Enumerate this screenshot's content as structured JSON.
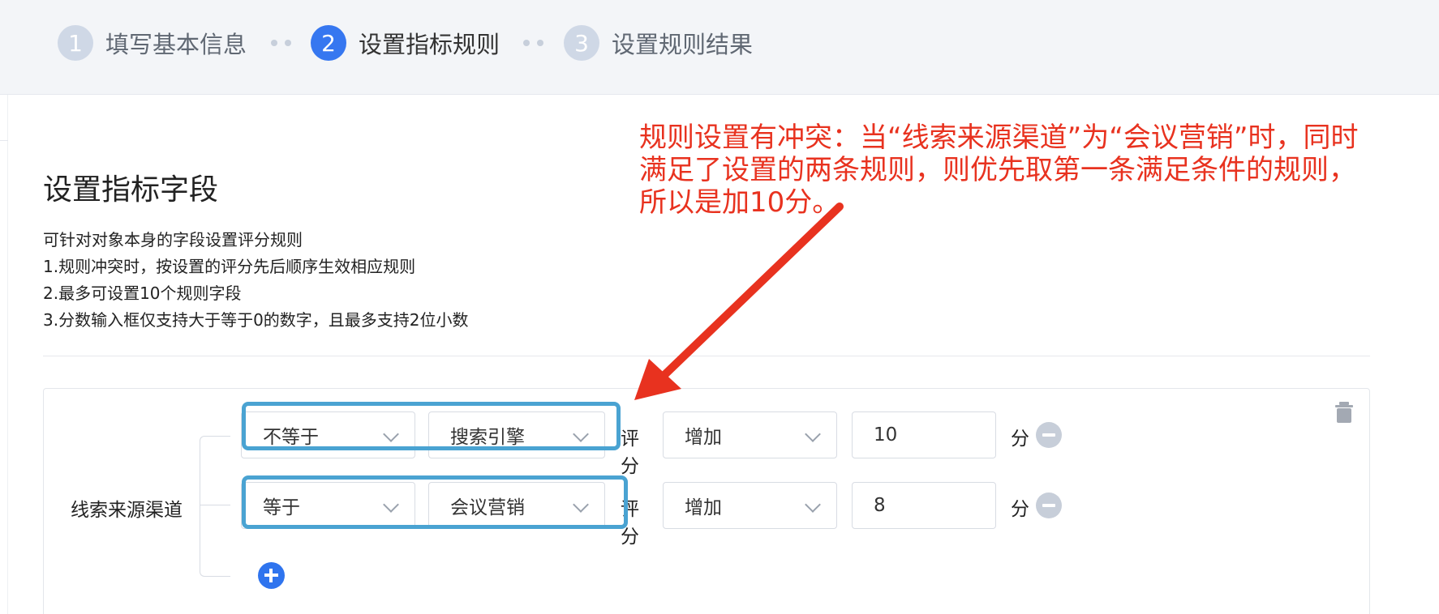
{
  "steps": [
    {
      "num": "1",
      "label": "填写基本信息",
      "state": "done"
    },
    {
      "num": "2",
      "label": "设置指标规则",
      "state": "active"
    },
    {
      "num": "3",
      "label": "设置规则结果",
      "state": "todo"
    }
  ],
  "section": {
    "title": "设置指标字段",
    "desc": [
      "可针对对象本身的字段设置评分规则",
      "1.规则冲突时，按设置的评分先后顺序生效相应规则",
      "2.最多可设置10个规则字段",
      "3.分数输入框仅支持大于等于0的数字，且最多支持2位小数"
    ]
  },
  "rule": {
    "field_name": "线索来源渠道",
    "score_label": "评分",
    "unit": "分",
    "rows": [
      {
        "operator": "不等于",
        "value": "搜索引擎",
        "action": "增加",
        "score": "10"
      },
      {
        "operator": "等于",
        "value": "会议营销",
        "action": "增加",
        "score": "8"
      }
    ]
  },
  "annotation": {
    "lines": [
      "规则设置有冲突：当“线索来源渠道”为“会议营销”时，同时",
      "满足了设置的两条规则，则优先取第一条满足条件的规则，",
      "所以是加10分。"
    ],
    "color": "#e8321f"
  },
  "colors": {
    "accent": "#3677f0",
    "highlight": "#4aa3d2",
    "step_inactive": "#cfd8e6"
  },
  "icons": {
    "delete": "trash-icon",
    "add": "plus-circle-icon",
    "remove": "minus-circle-icon",
    "dropdown": "chevron-down-icon"
  }
}
